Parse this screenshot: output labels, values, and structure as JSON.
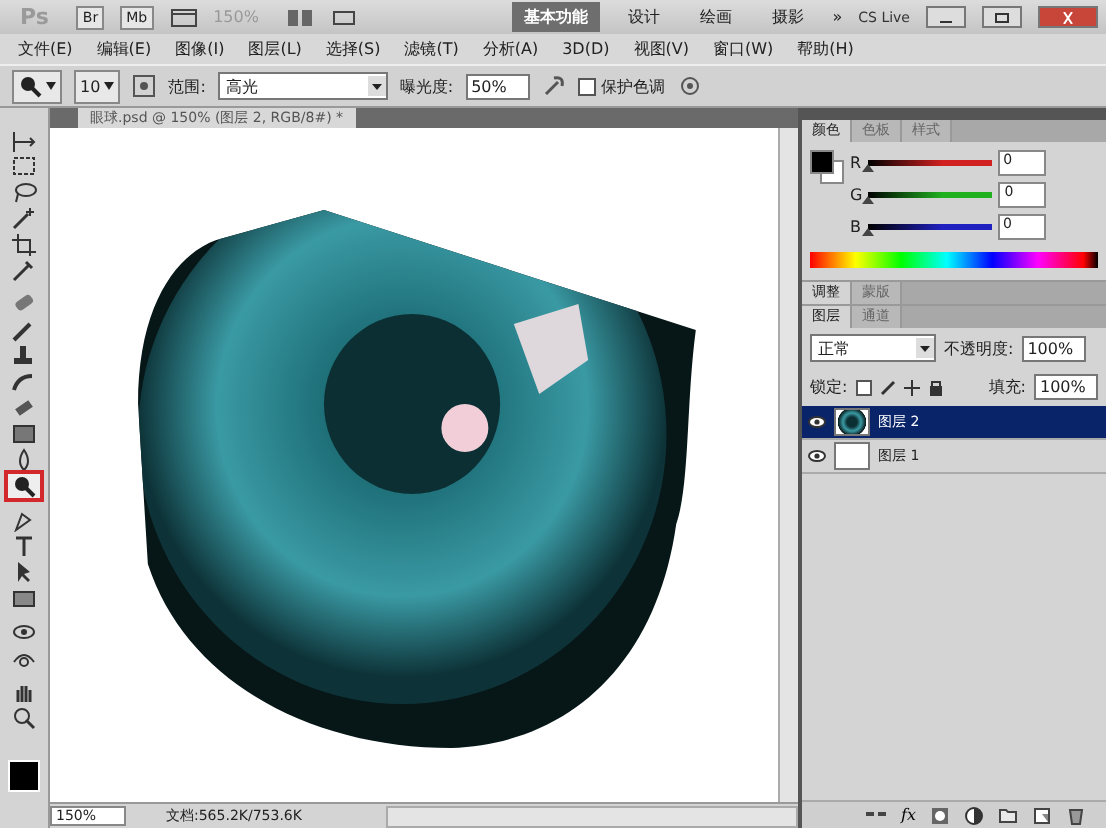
{
  "app_bar": {
    "logo": "Ps",
    "launchers": [
      "Br",
      "Mb"
    ],
    "zoom": "150%",
    "workspaces": [
      {
        "label": "基本功能",
        "selected": true
      },
      {
        "label": "设计",
        "selected": false
      },
      {
        "label": "绘画",
        "selected": false
      },
      {
        "label": "摄影",
        "selected": false
      }
    ],
    "more": "»",
    "cs_live": "CS Live"
  },
  "menu": [
    "文件(E)",
    "编辑(E)",
    "图像(I)",
    "图层(L)",
    "选择(S)",
    "滤镜(T)",
    "分析(A)",
    "3D(D)",
    "视图(V)",
    "窗口(W)",
    "帮助(H)"
  ],
  "options": {
    "brush_size": "10",
    "range_label": "范围:",
    "range": "高光",
    "exposure_label": "曝光度:",
    "exposure": "50%",
    "protect_tones": {
      "label": "保护色调",
      "checked": false
    }
  },
  "document": {
    "tab": "眼球.psd @ 150% (图层 2, RGB/8#) *",
    "zoom": "150%",
    "doc_info": "文档:565.2K/753.6K"
  },
  "tools": [
    {
      "kind": "move",
      "selected": false
    },
    {
      "kind": "marquee",
      "selected": false
    },
    {
      "kind": "lasso",
      "selected": false
    },
    {
      "kind": "wand",
      "selected": false
    },
    {
      "kind": "crop",
      "selected": false
    },
    {
      "kind": "eyedropper",
      "selected": false
    },
    {
      "kind": "healing",
      "selected": false
    },
    {
      "kind": "brush",
      "selected": false
    },
    {
      "kind": "stamp",
      "selected": false
    },
    {
      "kind": "history",
      "selected": false
    },
    {
      "kind": "eraser",
      "selected": false
    },
    {
      "kind": "gradient",
      "selected": false
    },
    {
      "kind": "blur",
      "selected": false
    },
    {
      "kind": "dodge",
      "selected": true
    },
    {
      "kind": "pen",
      "selected": false
    },
    {
      "kind": "type",
      "selected": false
    },
    {
      "kind": "path",
      "selected": false
    },
    {
      "kind": "shape",
      "selected": false
    },
    {
      "kind": "rotate3d",
      "selected": false
    },
    {
      "kind": "orbit3d",
      "selected": false
    },
    {
      "kind": "hand",
      "selected": false
    },
    {
      "kind": "zoom",
      "selected": false
    }
  ],
  "color_panel": {
    "tabs": [
      {
        "label": "颜色",
        "selected": true
      },
      {
        "label": "色板",
        "selected": false
      },
      {
        "label": "样式",
        "selected": false
      }
    ],
    "channels": [
      {
        "name": "R",
        "color": "#d02020",
        "value": "0",
        "level": 0
      },
      {
        "name": "G",
        "color": "#20b020",
        "value": "0",
        "level": 0
      },
      {
        "name": "B",
        "color": "#2020c0",
        "value": "0",
        "level": 0
      }
    ]
  },
  "adjust_panel": {
    "tabs": [
      {
        "label": "调整",
        "selected": true
      },
      {
        "label": "蒙版",
        "selected": false
      }
    ]
  },
  "layers_panel": {
    "tabs": [
      {
        "label": "图层",
        "selected": true
      },
      {
        "label": "通道",
        "selected": false
      }
    ],
    "blend_mode": "正常",
    "opacity_label": "不透明度:",
    "opacity": "100%",
    "lock_label": "锁定:",
    "fill_label": "填充:",
    "fill": "100%",
    "layers": [
      {
        "name": "图层 2",
        "kind": "eye",
        "visible": true,
        "selected": true
      },
      {
        "name": "图层 1",
        "kind": "blank",
        "visible": true,
        "selected": false
      }
    ],
    "footer": [
      {
        "kind": "link"
      },
      {
        "kind": "fx",
        "label": "fx"
      },
      {
        "kind": "mask"
      },
      {
        "kind": "adjust"
      },
      {
        "kind": "folder"
      },
      {
        "kind": "new"
      },
      {
        "kind": "trash"
      }
    ]
  }
}
